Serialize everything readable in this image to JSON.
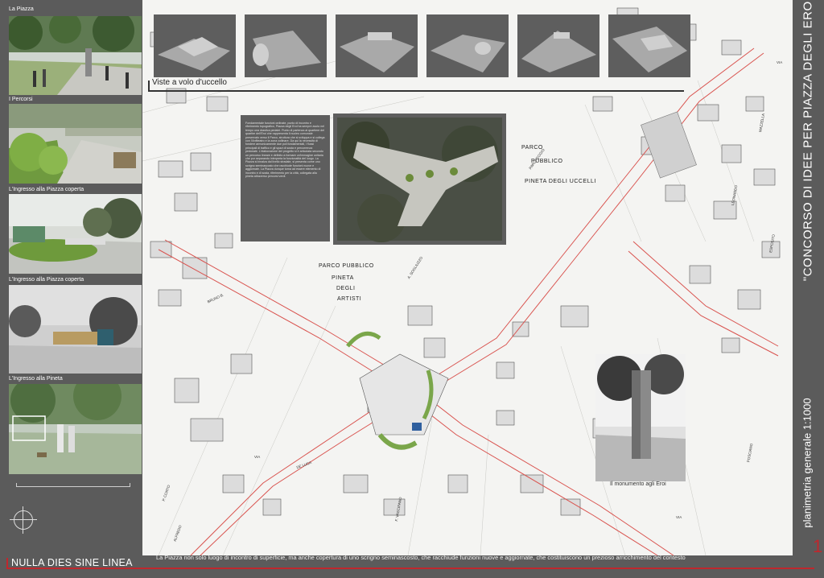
{
  "left_panel": {
    "photos": [
      {
        "label": "La Piazza"
      },
      {
        "label": "I Percorsi"
      },
      {
        "label": "L'Ingresso alla Piazza coperta"
      },
      {
        "label": "L'Ingresso alla Piazza coperta"
      },
      {
        "label": "L'Ingresso alla Pineta"
      }
    ]
  },
  "header": {
    "views_caption": "Viste a volo d'uccello"
  },
  "map": {
    "park_top": [
      "PARCO",
      "PUBBLICO",
      "PINETA  DEGLI  UCCELLI"
    ],
    "park_left": [
      "PARCO  PUBBLICO",
      "PINETA",
      "DEGLI",
      "ARTISTI"
    ],
    "monument_caption": "Il monumento agli Eroi",
    "parking": "PARCHEGGIO",
    "streets": [
      "A. SOGLIUZZO",
      "DE LUCA",
      "VIA",
      "VIA",
      "VIA",
      "F. VASCIPANO",
      "BRUNO B.",
      "MAZZELLA",
      "LEONARDO",
      "ESPOSITO",
      "POSCIANO",
      "P. CORTO",
      "ALFREDO"
    ]
  },
  "text_box": {
    "text": "Fondamentale funzioni ordinate, punto di incontro e riferimento topografico, Piazza degli Eroi ha sempre avuto nel tempo una drastica pedalei. Punto di partenza al quartiere del quartire dell'Eroi che rappresenta il nucleo comunale preservato verso il Parco, struttura che si sviluppa e si collega con l'Anfiteatro e la zona collinare. Da qui la necessità di fondere armonicamente due poli fondamentali, i flussi principali di traffico e gli spazi di sosta e percorrenza pedonale. L'elaborazione del progetto si è articolata secondo un percorso lineare e definito a formare un'immagine unitaria che pur separando interpreta la funzionalità del luogo. La Piazza si innalza dal livello stradale, si presenta come uno scrigno seminascosto che racchiude funzioni nuove e aggiornate. La Piazza dunque torna ad essere elemento di incontro e di sosta, riferimento per la città, collegata alla pineta attraverso percorsi verdi."
  },
  "title_block": {
    "title": "\"CONCORSO DI IDEE PER PIAZZA DEGLI EROI\"",
    "subtitle": "planimetria generale    1:1000",
    "sheet_number": "1"
  },
  "footer": {
    "motto": "NULLA DIES SINE LINEA",
    "caption": "La Piazza non solo luogo di incontro di superficie, ma anche copertura di uno scrigno seminascosto, che racchiude funzioni nuove e aggiornate, che costituiscono un prezioso arricchimento del contesto"
  },
  "colors": {
    "panel_gray": "#5b5b5b",
    "accent_red": "#c0272d",
    "road_red": "#d9534f",
    "green": "#7aa64a"
  }
}
